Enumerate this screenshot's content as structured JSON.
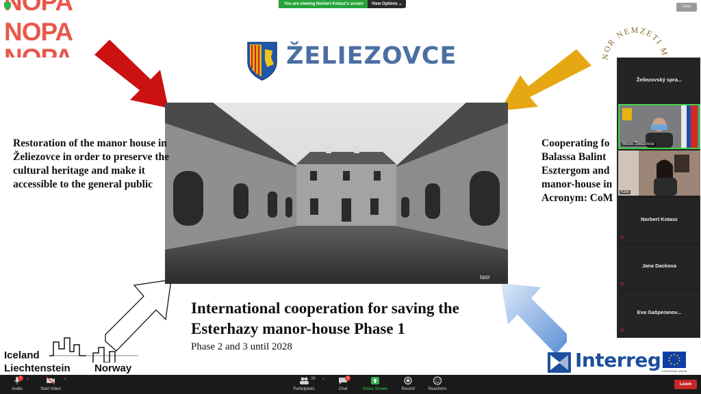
{
  "banner": {
    "message": "You are viewing Norbert Kotasz's screen",
    "options": "View Options ⌄"
  },
  "view_button": "View",
  "slide": {
    "nopa": [
      "NOPA",
      "NOPA",
      "NOPA"
    ],
    "circle_logo_text": "NOR NEMZETI MU",
    "town_name": "ŽELIEZOVCE",
    "left_text": "Restoration of the manor house in Želiezovce in order to preserve the cultural heritage and make it accessible to the general public",
    "right_text": [
      "Cooperating fo",
      "Balassa Balint",
      "Esztergom and",
      "manor-house in",
      "Acronym: CoM"
    ],
    "title": "International cooperation for saving the Esterhazy manor-house Phase 1",
    "subtitle": "Phase 2 and 3 until 2028",
    "photo_watermark": "tasr",
    "iceland_logo": {
      "line1": "Iceland",
      "line2": "Liechtenstein",
      "line3": "Norway"
    },
    "interreg": "Interreg",
    "eu_label": "EUROPEAN UNION",
    "colors": {
      "red_arrow": "#cc1111",
      "yellow_arrow": "#e6a812",
      "nopa": "#e8584b",
      "interreg": "#1d4f9c"
    }
  },
  "participants": [
    {
      "name": "Želiezovský spra...",
      "type": "name"
    },
    {
      "name": "Mesto Želiezovce",
      "type": "video"
    },
    {
      "name": "Kate",
      "type": "video"
    },
    {
      "name": "Norbert Kotasz",
      "type": "name"
    },
    {
      "name": "Jana Dackova",
      "type": "name"
    },
    {
      "name": "Eva Gašperanov...",
      "type": "name"
    }
  ],
  "toolbar": {
    "audio": "Audio",
    "video": "Start Video",
    "participants": "Participants",
    "participants_count": "36",
    "chat": "Chat",
    "chat_badge": "4",
    "share": "Share Screen",
    "record": "Record",
    "reactions": "Reactions",
    "leave": "Leave"
  }
}
